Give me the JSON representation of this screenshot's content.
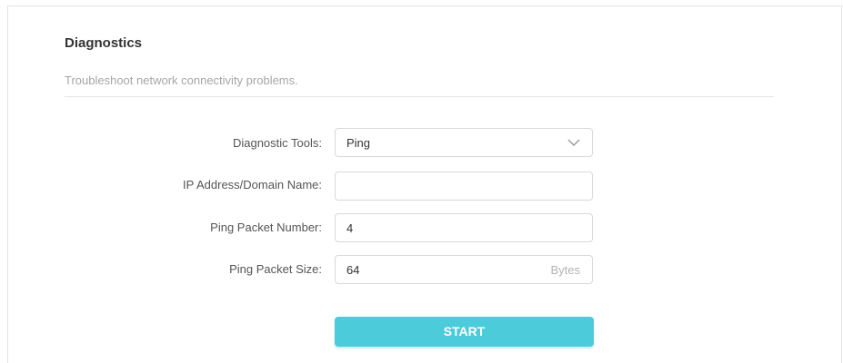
{
  "header": {
    "title": "Diagnostics",
    "subtitle": "Troubleshoot network connectivity problems."
  },
  "form": {
    "diagnostic_tools": {
      "label": "Diagnostic Tools:",
      "value": "Ping",
      "icon": "chevron-down-icon"
    },
    "ip_address": {
      "label": "IP Address/Domain Name:",
      "value": "",
      "placeholder": ""
    },
    "ping_packet_number": {
      "label": "Ping Packet Number:",
      "value": "4"
    },
    "ping_packet_size": {
      "label": "Ping Packet Size:",
      "value": "64",
      "unit": "Bytes"
    }
  },
  "actions": {
    "start_label": "START"
  },
  "colors": {
    "accent": "#4ccbdb",
    "border": "#d9d9d9",
    "muted_text": "#a6a6a6"
  }
}
